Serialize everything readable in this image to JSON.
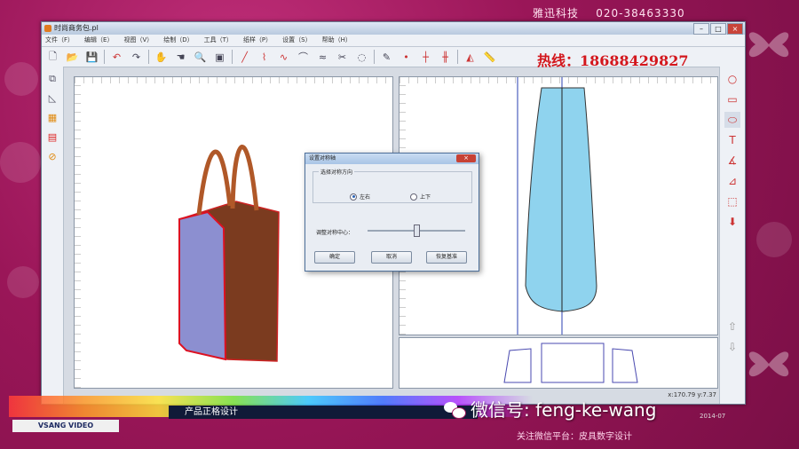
{
  "brand": {
    "company": "雅迅科技",
    "phone": "020-38463330"
  },
  "window": {
    "title": "时尚商务包.pl"
  },
  "menu": [
    "文件（F）",
    "编辑（E）",
    "视图（V）",
    "绘制（D）",
    "工具（T）",
    "纸样（P）",
    "设置（S）",
    "帮助（H）"
  ],
  "hotline": "热线：18688429827",
  "status": {
    "coords": "x:170.79    y:7.37"
  },
  "dialog": {
    "title": "设置对称轴",
    "close": "×",
    "group_label": "选择对称方向",
    "option_lr": "左右",
    "option_ud": "上下",
    "slider_label": "调整对称中心：",
    "ok": "确定",
    "cancel": "取消",
    "reset": "恢复基准"
  },
  "banner": {
    "caption": "产品正格设计",
    "video_logo": "VSANG VIDEO"
  },
  "wechat": {
    "text": "微信号: feng-ke-wang",
    "follow": "关注微信平台：皮具数字设计",
    "date": "2014-07"
  },
  "colors": {
    "frame": "#a0195d",
    "hotline": "#d3161c",
    "pattern_fill": "#8fd3ee",
    "bag_body": "#7b3b1f",
    "bag_side": "#8c8fd0"
  }
}
